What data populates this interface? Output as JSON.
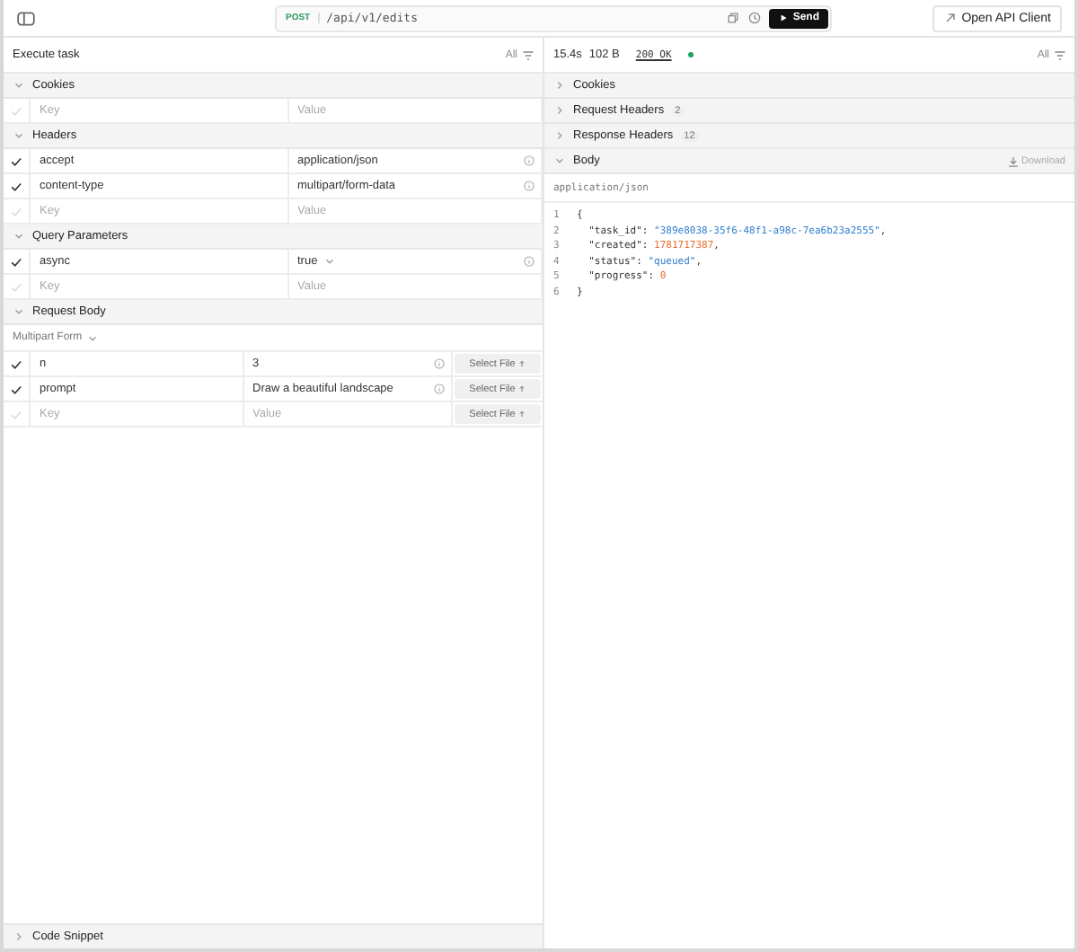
{
  "top_bar": {
    "method": "POST",
    "url": "/api/v1/edits",
    "send": "Send",
    "open_client": "Open API Client"
  },
  "request": {
    "title": "Execute task",
    "filter": "All",
    "sections": [
      {
        "title": "Cookies",
        "expanded": true,
        "rows": [
          {
            "kind": "empty",
            "key_placeholder": "Key",
            "value_placeholder": "Value",
            "checked": false
          }
        ]
      },
      {
        "title": "Headers",
        "expanded": true,
        "rows": [
          {
            "kind": "param",
            "key": "accept",
            "value": "application/json",
            "checked": true
          },
          {
            "kind": "param",
            "key": "content-type",
            "value": "multipart/form-data",
            "checked": true
          },
          {
            "kind": "empty",
            "key_placeholder": "Key",
            "value_placeholder": "Value",
            "checked": false
          }
        ]
      },
      {
        "title": "Query Parameters",
        "expanded": true,
        "rows": [
          {
            "kind": "select",
            "key": "async",
            "value": "true",
            "checked": true
          },
          {
            "kind": "empty",
            "key_placeholder": "Key",
            "value_placeholder": "Value",
            "checked": false
          }
        ]
      },
      {
        "title": "Request Body",
        "expanded": true,
        "mode": "Multipart Form",
        "rows": [
          {
            "kind": "param",
            "key": "n",
            "value": "3",
            "checked": true,
            "file": "Select File"
          },
          {
            "kind": "param",
            "key": "prompt",
            "value": "Draw a beautiful landscape",
            "checked": true,
            "file": "Select File"
          },
          {
            "kind": "empty",
            "key_placeholder": "Key",
            "value_placeholder": "Value",
            "checked": false,
            "file": "Select File"
          }
        ]
      }
    ],
    "footer": {
      "title": "Code Snippet",
      "expanded": false
    }
  },
  "response": {
    "time": "15.4s",
    "size": "102 B",
    "status": "200 OK",
    "filter": "All",
    "sections": [
      {
        "title": "Cookies",
        "expanded": false
      },
      {
        "title": "Request Headers",
        "count": "2",
        "expanded": false
      },
      {
        "title": "Response Headers",
        "count": "12",
        "expanded": false
      },
      {
        "title": "Body",
        "expanded": true,
        "action": "Download"
      }
    ],
    "content_type": "application/json",
    "lines": [
      {
        "number": "1",
        "tokens": [
          {
            "kind": "punct",
            "text": "{"
          }
        ]
      },
      {
        "number": "2",
        "tokens": [
          {
            "kind": "key",
            "text": "  \"task_id\": "
          },
          {
            "kind": "string",
            "text": "\"389e8038-35f6-48f1-a98c-7ea6b23a2555\""
          },
          {
            "kind": "punct",
            "text": ","
          }
        ]
      },
      {
        "number": "3",
        "tokens": [
          {
            "kind": "key",
            "text": "  \"created\": "
          },
          {
            "kind": "number",
            "text": "1781717387"
          },
          {
            "kind": "punct",
            "text": ","
          }
        ]
      },
      {
        "number": "4",
        "tokens": [
          {
            "kind": "key",
            "text": "  \"status\": "
          },
          {
            "kind": "string",
            "text": "\"queued\""
          },
          {
            "kind": "punct",
            "text": ","
          }
        ]
      },
      {
        "number": "5",
        "tokens": [
          {
            "kind": "key",
            "text": "  \"progress\": "
          },
          {
            "kind": "number",
            "text": "0"
          }
        ]
      },
      {
        "number": "6",
        "tokens": [
          {
            "kind": "punct",
            "text": "}"
          }
        ]
      }
    ]
  }
}
